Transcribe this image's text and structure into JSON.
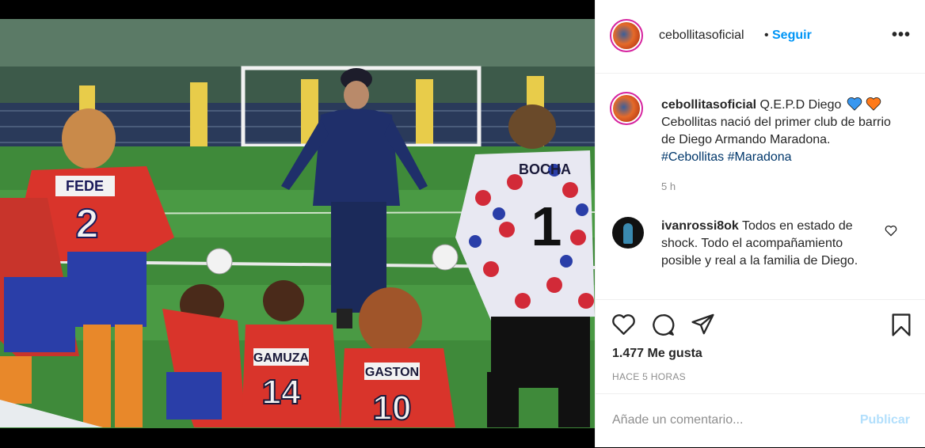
{
  "post": {
    "username": "cebollitasoficial",
    "dot": "•",
    "follow_label": "Seguir",
    "more_label": "•••",
    "caption": {
      "text": "Q.E.P.D Diego",
      "line2": "Cebollitas nació del primer club de barrio de Diego Armando Maradona.",
      "hashtags": [
        "#Cebollitas",
        "#Maradona"
      ],
      "time": "5 h"
    },
    "comment": {
      "username": "ivanrossi8ok",
      "text": "Todos en estado de shock. Todo el acompañamiento posible y real a la familia de Diego."
    },
    "likes": "1.477 Me gusta",
    "posted_ago": "HACE 5 HORAS",
    "add_comment_placeholder": "Añade un comentario...",
    "publish_label": "Publicar"
  },
  "photo": {
    "shirts": [
      "FEDE",
      "2",
      "BOCHA",
      "1",
      "GAMUZA",
      "14",
      "GASTON",
      "10"
    ]
  },
  "colors": {
    "link": "#0095f6",
    "hashtag": "#00376b",
    "heart_blue": "#3897f0",
    "heart_orange": "#ff7a1a"
  }
}
